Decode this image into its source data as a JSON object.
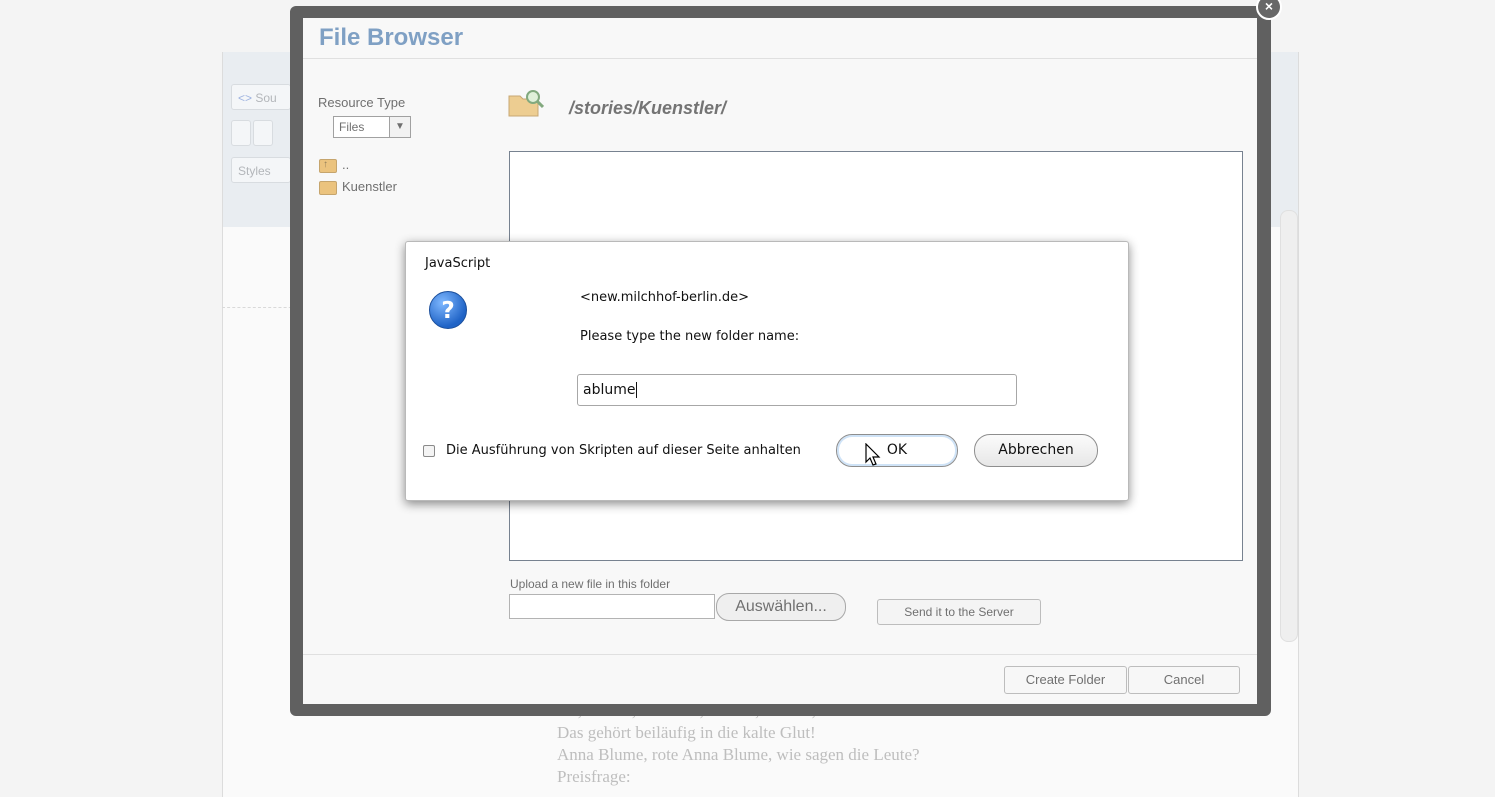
{
  "background_editor": {
    "toolbar": {
      "source_label": "Sou",
      "styles_label": "Styles"
    },
    "text_lines": [
      "Du, Deiner, Dich Dir, ich Dir, Du mir, ----- wir?",
      "Das gehört beiläufig in die kalte Glut!",
      "Anna Blume, rote Anna Blume, wie sagen die Leute?",
      "Preisfrage:"
    ]
  },
  "file_browser": {
    "title": "File Browser",
    "resource_type": {
      "label": "Resource Type",
      "selected": "Files"
    },
    "tree": [
      {
        "label": "..",
        "icon": "folder-up-icon"
      },
      {
        "label": "Kuenstler",
        "icon": "folder-icon"
      }
    ],
    "current_path": "/stories/Kuenstler/",
    "upload": {
      "label": "Upload a new file in this folder",
      "browse_label": "Auswählen...",
      "send_label": "Send it to the Server"
    },
    "footer": {
      "create_folder_label": "Create Folder",
      "cancel_label": "Cancel"
    },
    "close_glyph": "×"
  },
  "dialog": {
    "title": "JavaScript",
    "icon": "question-icon",
    "icon_glyph": "?",
    "origin": "<new.milchhof-berlin.de>",
    "prompt": "Please type the new folder name:",
    "input_value": "ablume",
    "checkbox_label": "Die Ausführung von Skripten auf dieser Seite anhalten",
    "ok_label": "OK",
    "cancel_label": "Abbrechen"
  }
}
